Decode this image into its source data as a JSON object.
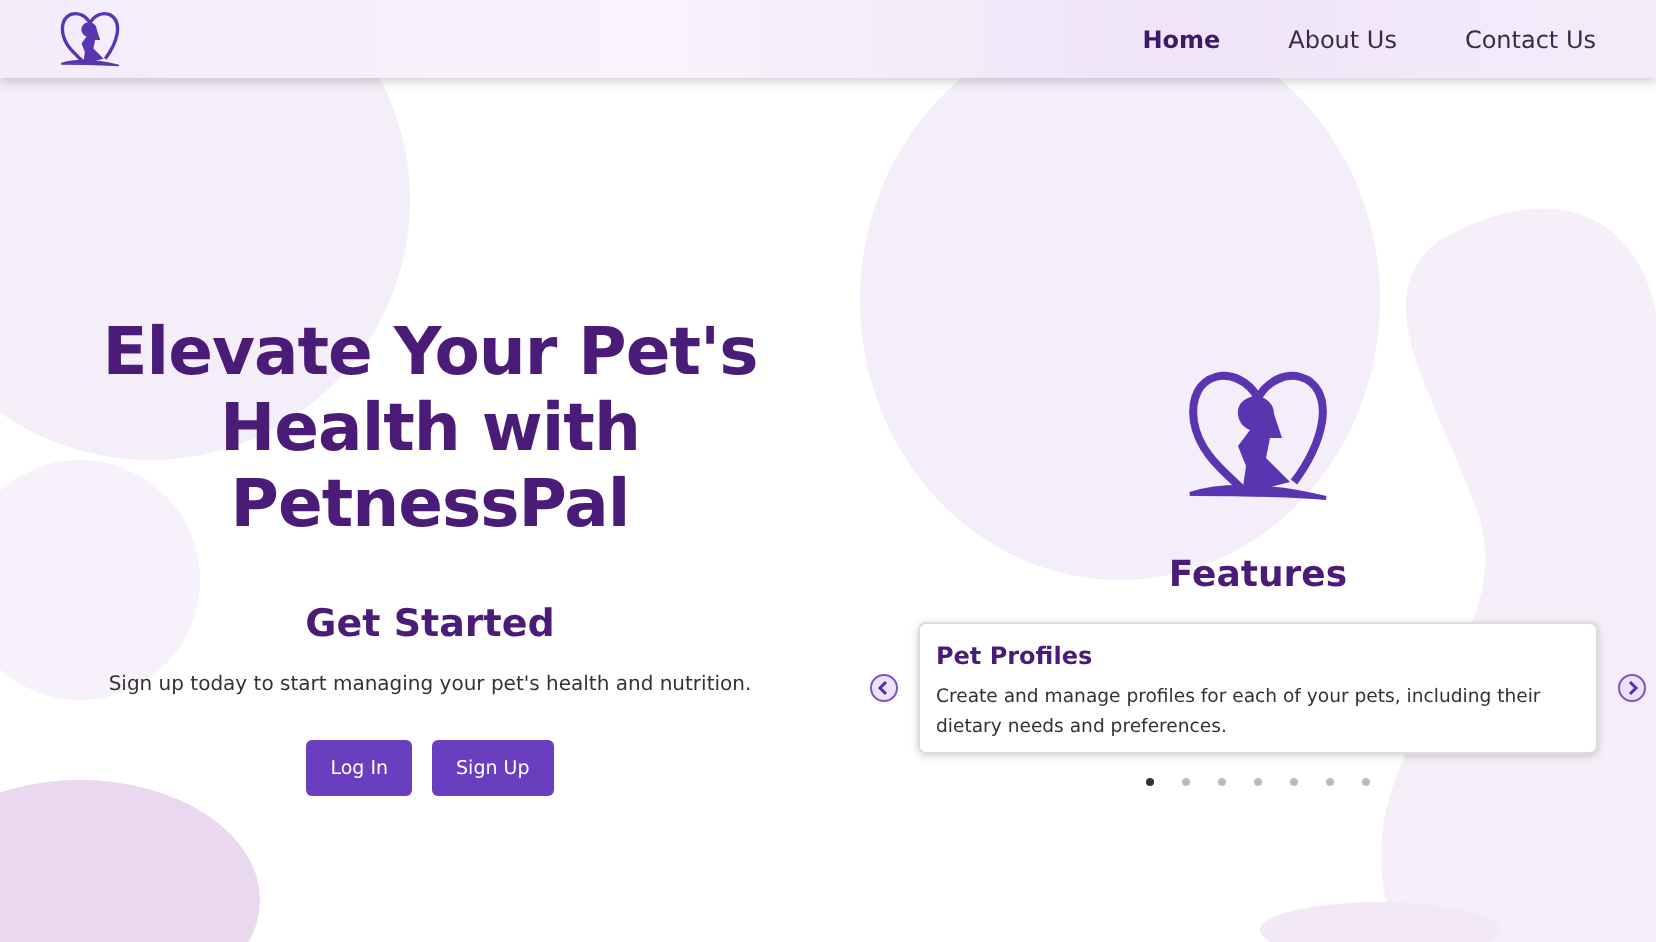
{
  "nav": {
    "links": [
      {
        "label": "Home",
        "selected": true
      },
      {
        "label": "About Us",
        "selected": false
      },
      {
        "label": "Contact Us",
        "selected": false
      }
    ]
  },
  "hero": {
    "title": "Elevate Your Pet's Health with PetnessPal",
    "subtitle": "Get Started",
    "text": "Sign up today to start managing your pet's health and nutrition.",
    "buttons": [
      "Log In",
      "Sign Up"
    ]
  },
  "features": {
    "title": "Features",
    "card": {
      "title": "Pet Profiles",
      "text": "Create and manage profiles for each of your pets, including their dietary needs and preferences."
    },
    "dots": [
      {
        "selected": true
      },
      {
        "selected": false
      },
      {
        "selected": false
      },
      {
        "selected": false
      },
      {
        "selected": false
      },
      {
        "selected": false
      },
      {
        "selected": false
      }
    ]
  }
}
